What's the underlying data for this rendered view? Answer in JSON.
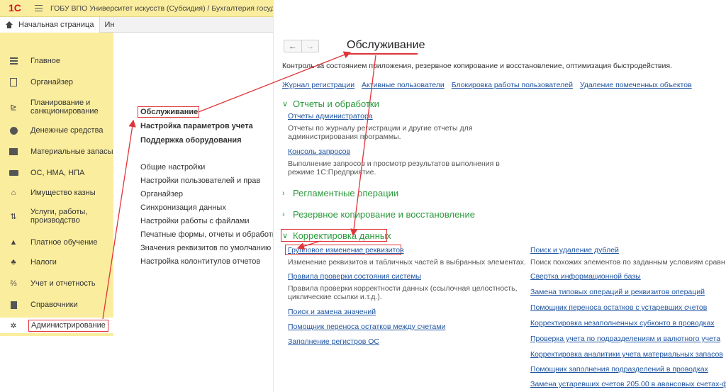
{
  "header": {
    "logo_text": "1С",
    "app_title": "ГОБУ ВПО Университет искусств (Субсидия) / Бухгалтерия госуда"
  },
  "tabs": {
    "home": "Начальная страница",
    "other": "Ин"
  },
  "sidebar": {
    "items": [
      {
        "label": "Главное",
        "icon": "menu-lines-icon"
      },
      {
        "label": "Органайзер",
        "icon": "document-icon"
      },
      {
        "label": "Планирование и\nсанкционирование",
        "icon": "planning-icon"
      },
      {
        "label": "Денежные средства",
        "icon": "money-icon"
      },
      {
        "label": "Материальные запасы",
        "icon": "inventory-icon"
      },
      {
        "label": "ОС, НМА, НПА",
        "icon": "truck-icon"
      },
      {
        "label": "Имущество казны",
        "icon": "treasury-icon"
      },
      {
        "label": "Услуги, работы,\nпроизводство",
        "icon": "services-icon"
      },
      {
        "label": "Платное обучение",
        "icon": "graduation-cap-icon"
      },
      {
        "label": "Налоги",
        "icon": "taxes-icon"
      },
      {
        "label": "Учет и отчетность",
        "icon": "reports-icon"
      },
      {
        "label": "Справочники",
        "icon": "book-icon"
      },
      {
        "label": "Администрирование",
        "icon": "gear-icon",
        "active": true
      }
    ]
  },
  "menu": {
    "bold_items": [
      "Обслуживание",
      "Настройка параметров учета",
      "Поддержка оборудования"
    ],
    "items": [
      "Общие настройки",
      "Настройки пользователей и прав",
      "Органайзер",
      "Синхронизация данных",
      "Настройки работы с файлами",
      "Печатные формы, отчеты и обработки",
      "Значения реквизитов по умолчанию",
      "Настройка колонтитулов отчетов"
    ]
  },
  "content": {
    "nav_back": "←",
    "nav_forward": "→",
    "title": "Обслуживание",
    "description": "Контроль за состоянием приложения, резервное копирование и восстановление, оптимизация быстродействия.",
    "top_links": [
      "Журнал регистрации",
      "Активные пользователи",
      "Блокировка работы пользователей",
      "Удаление помеченных объектов"
    ],
    "sections": {
      "reports": {
        "title": "Отчеты и обработки",
        "links": [
          {
            "label": "Отчеты администратора",
            "desc": "Отчеты по журналу регистрации и другие отчеты для\nадминистрирования программы."
          },
          {
            "label": "Консоль запросов",
            "desc": "Выполнение запросов и просмотр результатов выполнения в\nрежиме 1С:Предприятие."
          }
        ]
      },
      "scheduled": {
        "title": "Регламентные операции"
      },
      "backup": {
        "title": "Резервное копирование и восстановление"
      },
      "correction": {
        "title": "Корректировка данных",
        "left_links": [
          {
            "label": "Групповое изменение реквизитов",
            "desc": "Изменение реквизитов и табличных частей в выбранных элементах."
          },
          {
            "label": "Правила проверки состояния системы",
            "desc": "Правила проверки корректности данных (ссылочная целостность,\nциклические ссылки и.т.д.)."
          },
          {
            "label": "Поиск и замена значений",
            "desc": ""
          },
          {
            "label": "Помощник переноса остатков между счетами",
            "desc": ""
          },
          {
            "label": "Заполнение регистров ОС",
            "desc": ""
          }
        ],
        "right_links": [
          {
            "label": "Поиск и удаление дублей",
            "desc": "Поиск похожих элементов по заданным условиям сравн"
          },
          {
            "label": "Свертка информационной базы",
            "desc": ""
          },
          {
            "label": "Замена типовых операций и реквизитов операций",
            "desc": ""
          },
          {
            "label": "Помощник переноса остатков с устаревших счетов",
            "desc": ""
          },
          {
            "label": "Корректировка незаполненных субконто в проводках",
            "desc": ""
          },
          {
            "label": "Проверка учета по подразделениям и валютного учета",
            "desc": ""
          },
          {
            "label": "Корректировка аналитики учета материальных запасов",
            "desc": ""
          },
          {
            "label": "Помощник заполнения подразделений в проводках",
            "desc": ""
          },
          {
            "label": "Замена устаревших счетов 205.00 в авансовых счетах-ф",
            "desc": ""
          }
        ]
      }
    }
  },
  "colors": {
    "sidebar_bg": "#fbed9e",
    "accent_red": "#e0343a",
    "link_blue": "#1f54a0",
    "section_green": "#2a9a3c"
  }
}
